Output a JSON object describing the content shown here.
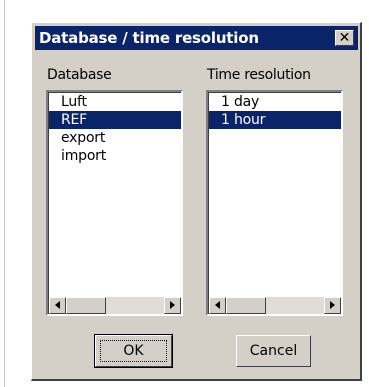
{
  "dialog": {
    "title": "Database / time resolution",
    "close_glyph": "✕"
  },
  "database": {
    "label": "Database",
    "items": [
      "Luft",
      "REF",
      "export",
      "import"
    ],
    "selected": "REF"
  },
  "time_resolution": {
    "label": "Time resolution",
    "items": [
      "1 day",
      "1 hour"
    ],
    "selected": "1 hour"
  },
  "buttons": {
    "ok": "OK",
    "cancel": "Cancel"
  },
  "icons": {
    "close": "close-icon",
    "scroll_left": "arrow-left-icon",
    "scroll_right": "arrow-right-icon"
  },
  "colors": {
    "titlebar": "#0a246a",
    "selection": "#0a246a",
    "face": "#d4d0c8"
  }
}
